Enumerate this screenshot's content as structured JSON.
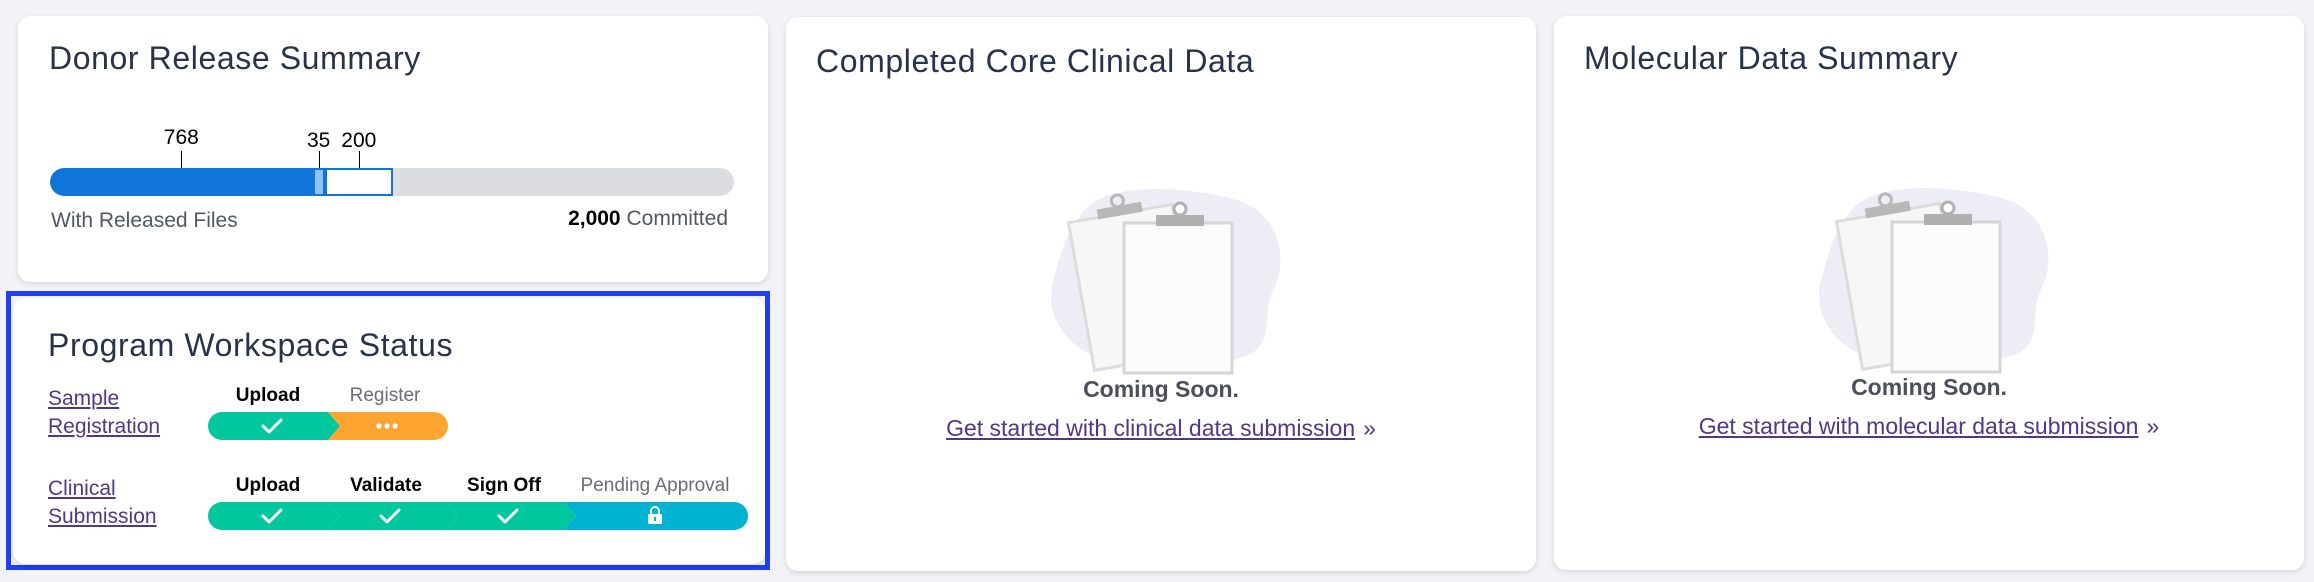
{
  "donor_release": {
    "title": "Donor Release Summary",
    "released_count": "768",
    "registered_count": "35",
    "uploaded_count": "200",
    "committed_value": "2,000",
    "committed_label": "Committed",
    "released_label": "With Released Files",
    "bar": {
      "committed_total": 2000,
      "released": 768,
      "registered": 35,
      "uploaded": 200
    },
    "colors": {
      "released": "#0f75d8",
      "registered": "#8fc3f0",
      "uploaded": "#ffffff",
      "track": "#dcdde1"
    }
  },
  "workspace": {
    "title": "Program Workspace Status",
    "rows": [
      {
        "link_line1": "Sample",
        "link_line2": "Registration",
        "steps": [
          {
            "label": "Upload",
            "status": "complete",
            "icon": "check-icon",
            "color": "#00c79d"
          },
          {
            "label": "Register",
            "status": "in-progress",
            "icon": "dots-icon",
            "color": "#fea430"
          }
        ]
      },
      {
        "link_line1": "Clinical",
        "link_line2": "Submission",
        "steps": [
          {
            "label": "Upload",
            "status": "complete",
            "icon": "check-icon",
            "color": "#00c79d"
          },
          {
            "label": "Validate",
            "status": "complete",
            "icon": "check-icon",
            "color": "#00c79d"
          },
          {
            "label": "Sign Off",
            "status": "complete",
            "icon": "check-icon",
            "color": "#00c79d"
          },
          {
            "label": "Pending Approval",
            "status": "locked",
            "icon": "lock-icon",
            "color": "#00b3d3"
          }
        ]
      }
    ]
  },
  "clinical": {
    "title": "Completed Core Clinical Data",
    "coming_soon": "Coming Soon.",
    "cta_link": "Get started with clinical data submission",
    "cta_suffix": "»"
  },
  "molecular": {
    "title": "Molecular Data Summary",
    "coming_soon": "Coming Soon.",
    "cta_link": "Get started with molecular data submission",
    "cta_suffix": "»"
  }
}
